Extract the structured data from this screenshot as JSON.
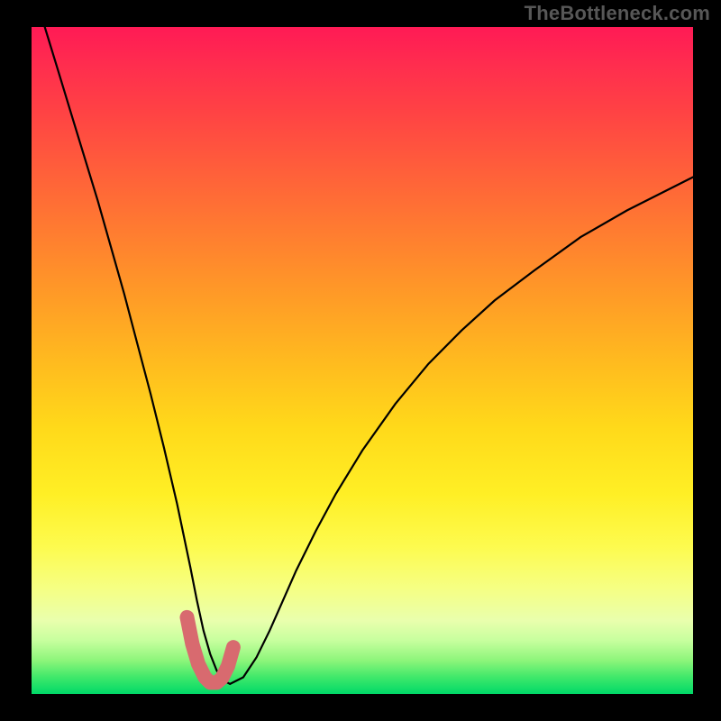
{
  "watermark": "TheBottleneck.com",
  "chart_data": {
    "type": "line",
    "title": "",
    "xlabel": "",
    "ylabel": "",
    "x_range": [
      0,
      100
    ],
    "y_range": [
      0,
      100
    ],
    "series": [
      {
        "name": "curve",
        "x": [
          2,
          4,
          6,
          8,
          10,
          12,
          14,
          16,
          18,
          20,
          22,
          24,
          25,
          26,
          27,
          28,
          29,
          30,
          32,
          34,
          36,
          38,
          40,
          43,
          46,
          50,
          55,
          60,
          65,
          70,
          76,
          83,
          90,
          100
        ],
        "y": [
          100,
          93.5,
          87,
          80.5,
          74,
          67,
          60,
          52.5,
          45,
          37,
          28.5,
          19,
          14,
          9.5,
          6,
          3.5,
          2,
          1.5,
          2.5,
          5.5,
          9.5,
          14,
          18.5,
          24.5,
          30,
          36.5,
          43.5,
          49.5,
          54.5,
          59,
          63.5,
          68.5,
          72.5,
          77.5
        ]
      },
      {
        "name": "highlight",
        "x": [
          23.5,
          24.3,
          25.2,
          26.2,
          27.0,
          28.0,
          28.8,
          29.7,
          30.5
        ],
        "y": [
          11.5,
          7.5,
          4.5,
          2.5,
          1.7,
          1.7,
          2.4,
          4.2,
          7.0
        ]
      }
    ],
    "gradient_stops": [
      {
        "pos": 0,
        "color": "#ff1a55"
      },
      {
        "pos": 0.3,
        "color": "#ff7a31"
      },
      {
        "pos": 0.6,
        "color": "#ffd91a"
      },
      {
        "pos": 0.84,
        "color": "#f6ff82"
      },
      {
        "pos": 1.0,
        "color": "#00d968"
      }
    ],
    "highlight_color": "#d86a6f"
  }
}
